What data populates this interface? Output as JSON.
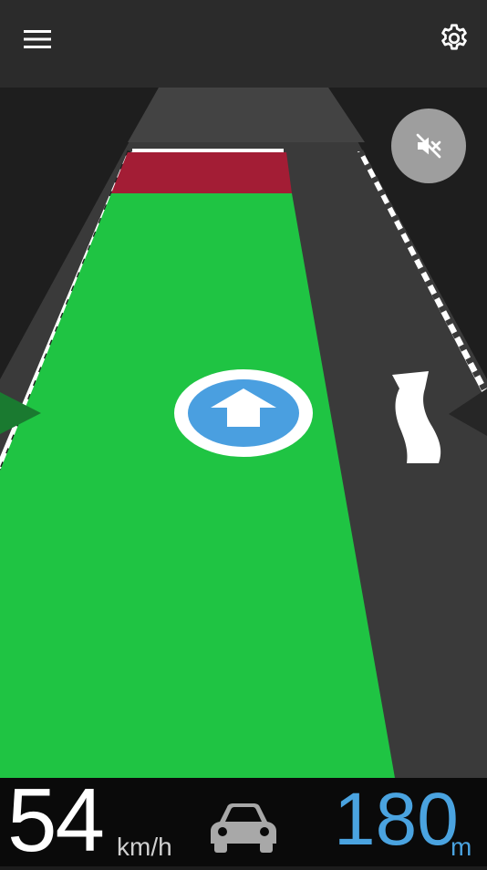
{
  "toolbar": {
    "menu_icon": "hamburger-menu-icon",
    "settings_icon": "gear-icon"
  },
  "navigation": {
    "mute_icon": "volume-muted-icon",
    "direction": "straight",
    "lane_arrow": "straight-arrow-icon",
    "adjacent_lane_marking": "curve-left-arrow-icon"
  },
  "status": {
    "speed": "54",
    "speed_unit": "km/h",
    "vehicle_icon": "car-icon",
    "distance": "180",
    "distance_unit": "m"
  },
  "colors": {
    "lane_green": "#1fc443",
    "stop_red": "#a31d35",
    "accent_blue": "#4aa3e0"
  }
}
